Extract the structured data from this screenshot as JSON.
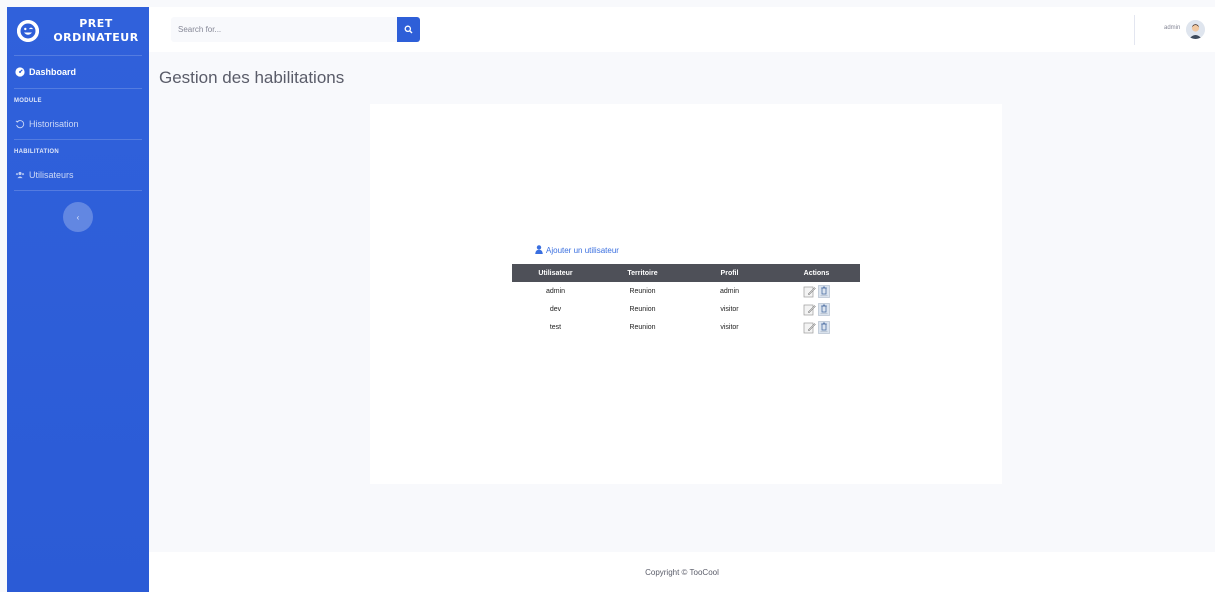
{
  "sidebar": {
    "brand_line1": "PRET",
    "brand_line2": "ORDINATEUR",
    "dashboard_label": "Dashboard",
    "heading_module": "MODULE",
    "historisation_label": "Historisation",
    "heading_habilitation": "HABILITATION",
    "utilisateurs_label": "Utilisateurs",
    "toggle_icon": "chevron-left-icon"
  },
  "topbar": {
    "search_placeholder": "Search for...",
    "user_name": "admin"
  },
  "main": {
    "title": "Gestion des habilitations",
    "add_user_label": "Ajouter un utilisateur",
    "table": {
      "headers": [
        "Utilisateur",
        "Territoire",
        "Profil",
        "Actions"
      ],
      "rows": [
        {
          "utilisateur": "admin",
          "territoire": "Reunion",
          "profil": "admin"
        },
        {
          "utilisateur": "dev",
          "territoire": "Reunion",
          "profil": "visitor"
        },
        {
          "utilisateur": "test",
          "territoire": "Reunion",
          "profil": "visitor"
        }
      ]
    }
  },
  "footer": {
    "copyright": "Copyright © TooCool"
  },
  "colors": {
    "sidebar": "#2e5ed8",
    "accent": "#2e5fd8",
    "table_header": "#4e5058",
    "link": "#3a6fe0"
  }
}
